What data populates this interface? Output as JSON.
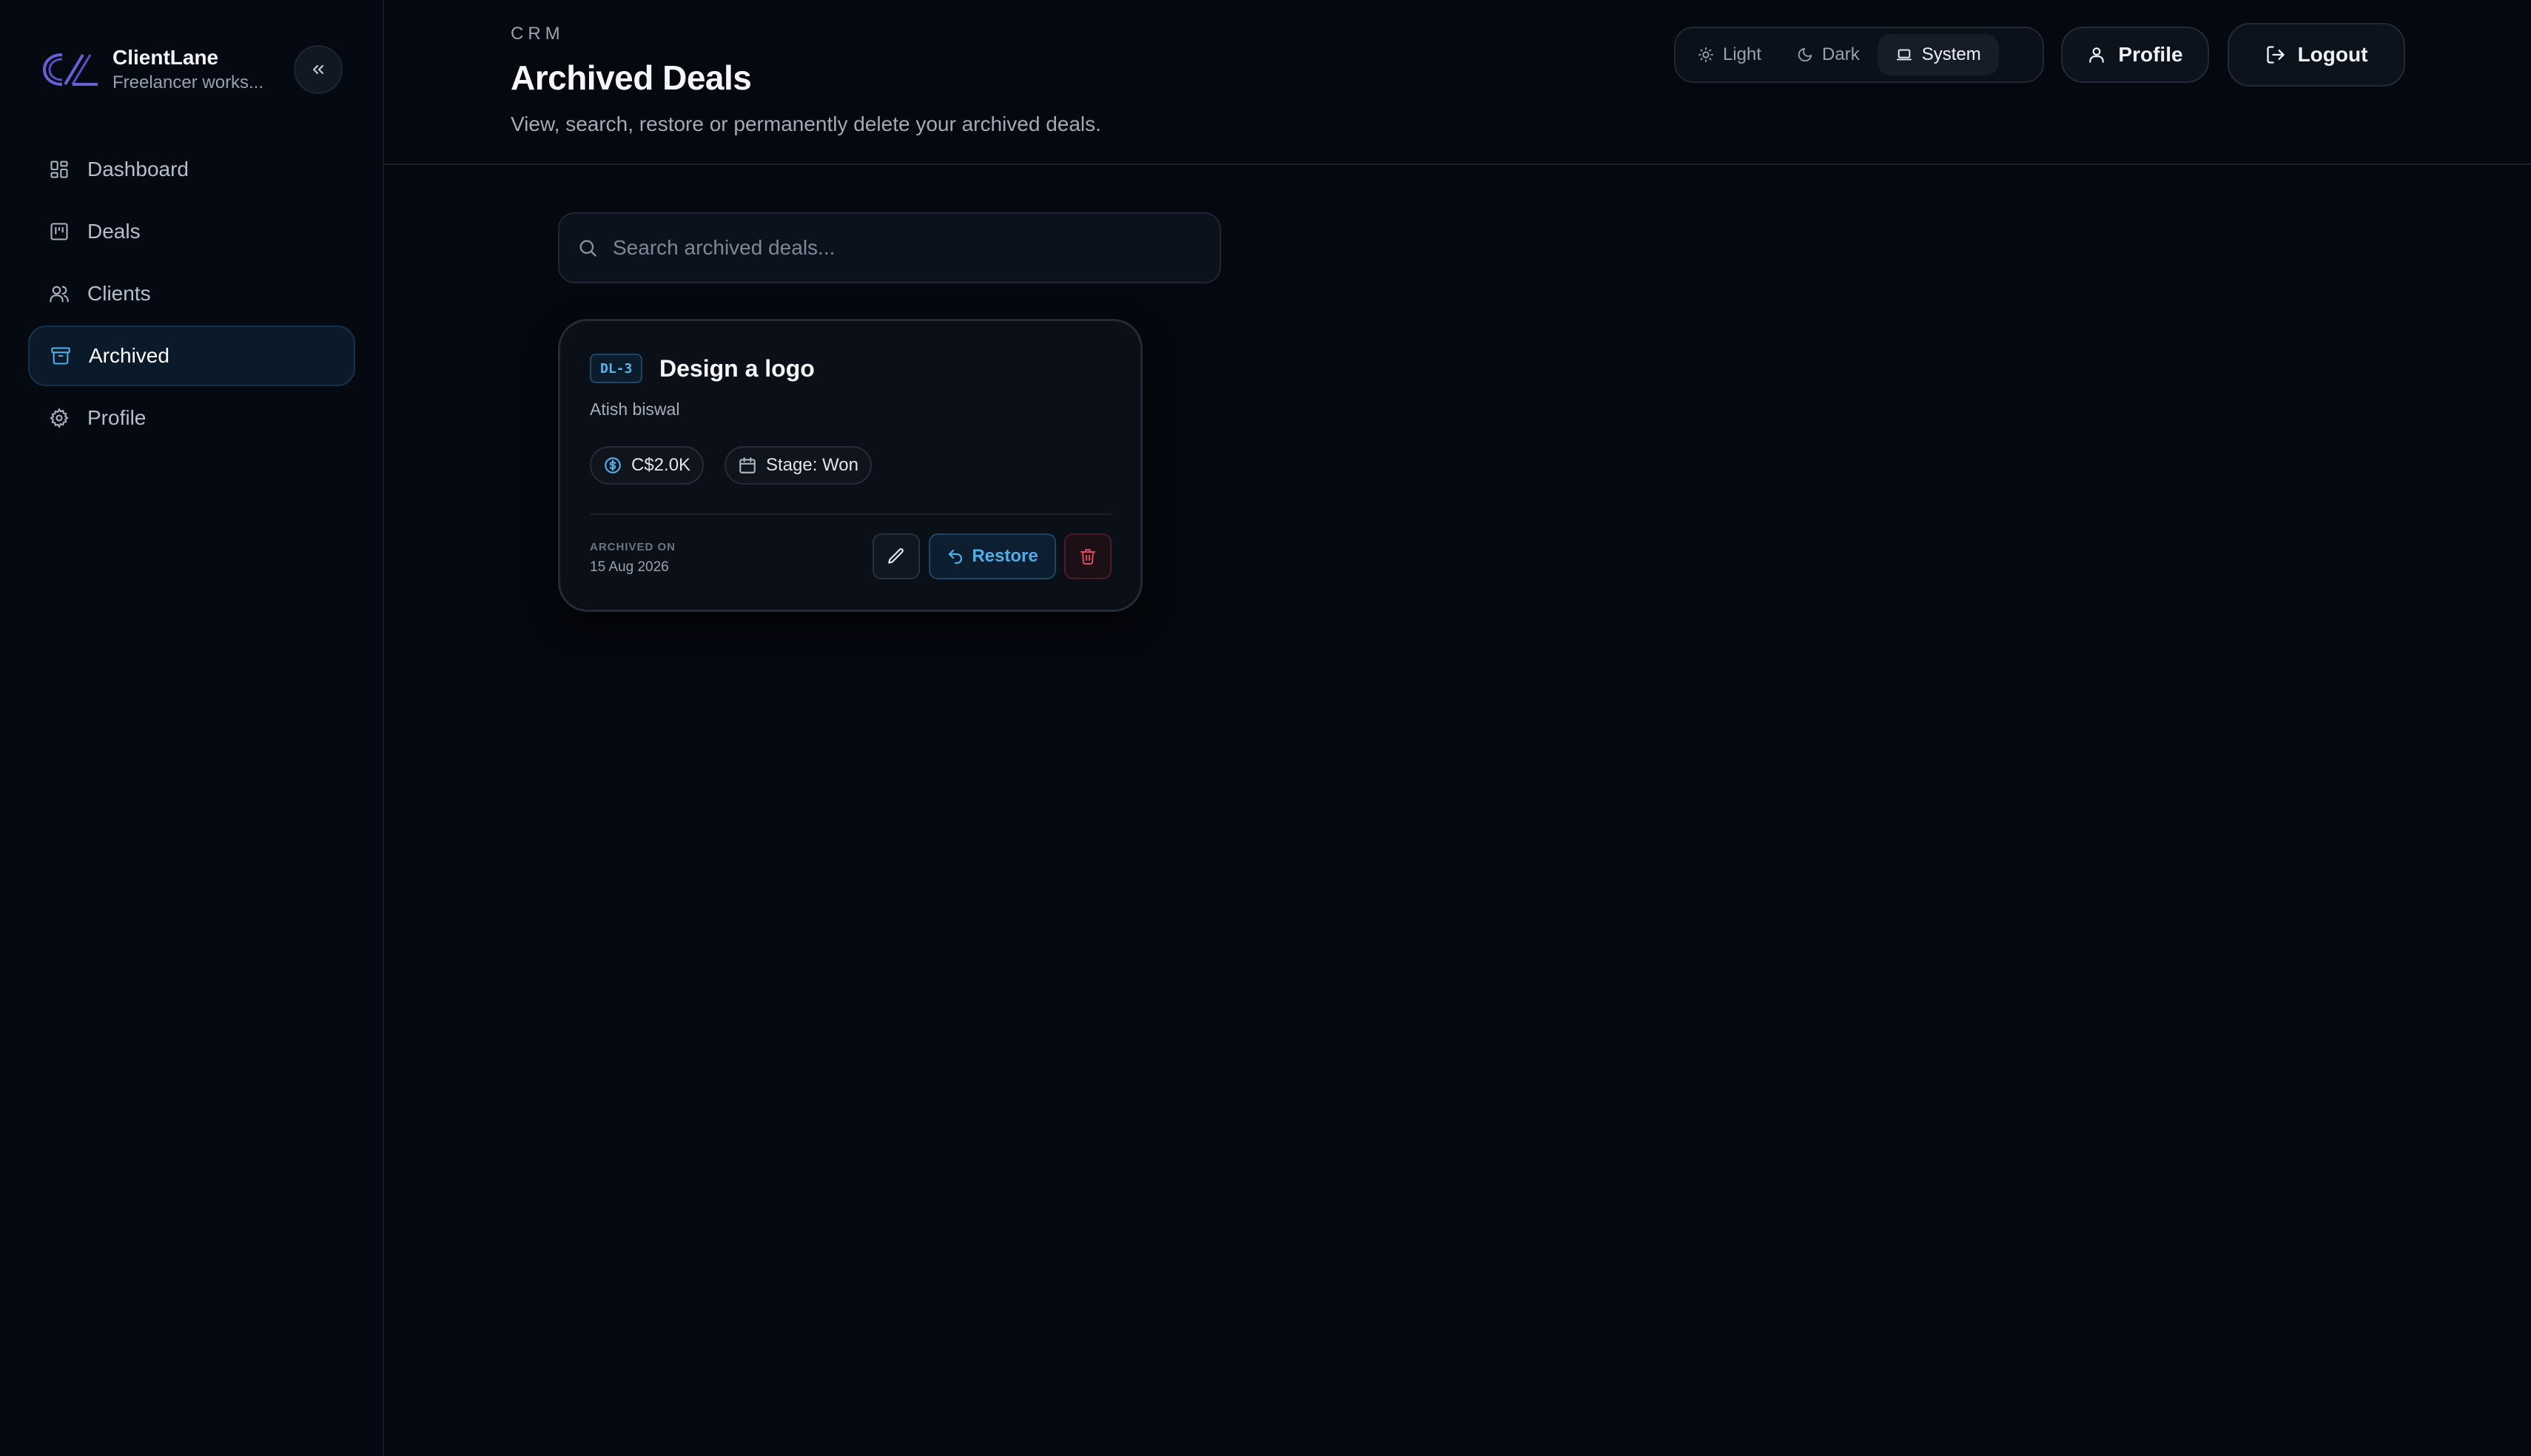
{
  "colors": {
    "background": "#05080f",
    "accent": "#4eaee8",
    "danger": "#e0485e",
    "brand_logo": "#6b5fd6"
  },
  "brand": {
    "name": "ClientLane",
    "subtitle": "Freelancer works..."
  },
  "sidebar": {
    "items": [
      {
        "label": "Dashboard",
        "icon": "dashboard-icon",
        "active": false
      },
      {
        "label": "Deals",
        "icon": "kanban-icon",
        "active": false
      },
      {
        "label": "Clients",
        "icon": "users-icon",
        "active": false
      },
      {
        "label": "Archived",
        "icon": "archive-icon",
        "active": true
      },
      {
        "label": "Profile",
        "icon": "gear-icon",
        "active": false
      }
    ]
  },
  "header": {
    "eyebrow": "CRM",
    "title": "Archived Deals",
    "subtitle": "View, search, restore or permanently delete your archived deals.",
    "theme": {
      "options": [
        "Light",
        "Dark",
        "System"
      ],
      "selected": "System"
    },
    "profile_label": "Profile",
    "logout_label": "Logout"
  },
  "search": {
    "placeholder": "Search archived deals...",
    "value": ""
  },
  "deals": [
    {
      "id": "DL-3",
      "title": "Design a logo",
      "client": "Atish biswal",
      "amount": "C$2.0K",
      "stage": "Stage: Won",
      "archived_label": "ARCHIVED ON",
      "archived_date": "15 Aug 2026",
      "restore_label": "Restore"
    }
  ]
}
